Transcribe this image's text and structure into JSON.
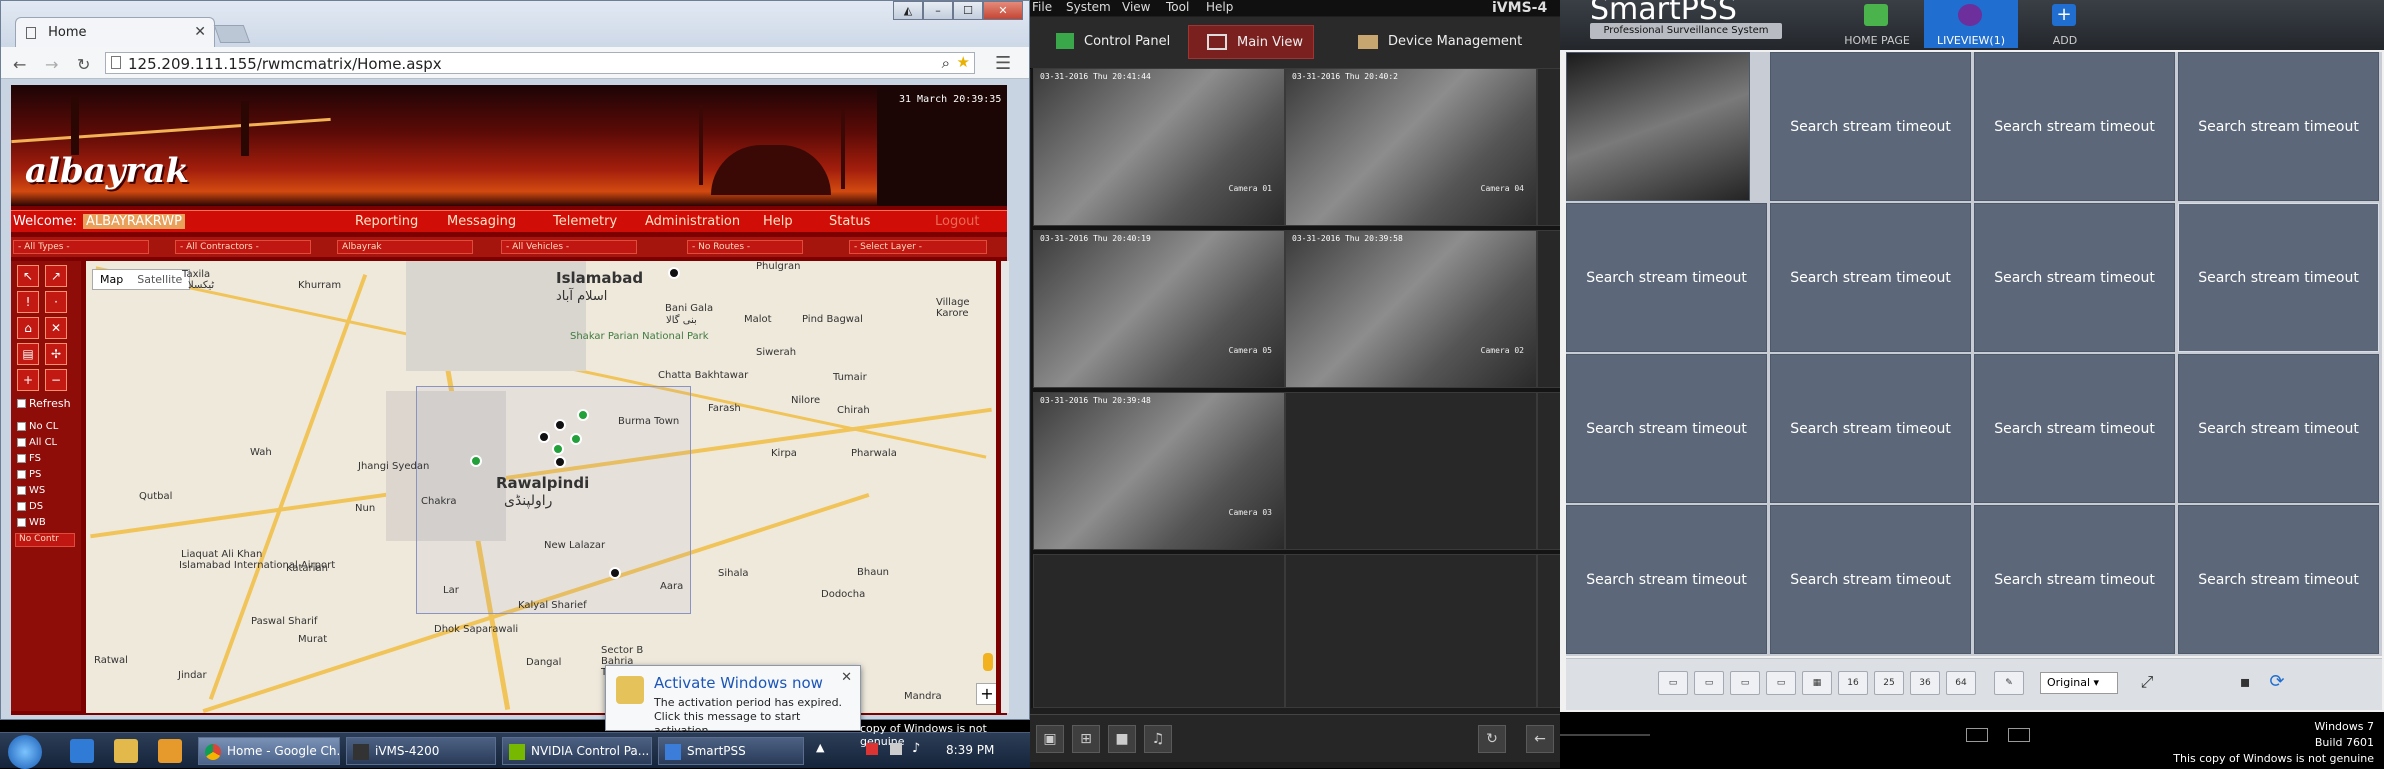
{
  "chrome": {
    "tab_title": "Home",
    "url": "125.209.111.155/rwmcmatrix/Home.aspx",
    "page": {
      "logo": "albayrak",
      "datetime": "31 March 20:39:35",
      "welcome_label": "Welcome:",
      "welcome_user": "ALBAYRAKRWP",
      "menu": [
        "Reporting",
        "Messaging",
        "Telemetry",
        "Administration",
        "Help",
        "Status"
      ],
      "logout": "Logout",
      "filters": [
        "- All Types -",
        "- All Contractors -",
        "Albayrak",
        "- All Vehicles -",
        "- No Routes -",
        "- Select Layer -"
      ],
      "refresh_label": "Refresh",
      "layer_checks": [
        "No CL",
        "All CL",
        "FS",
        "PS",
        "WS",
        "DS",
        "WB"
      ],
      "contract_dropdown": "No Contr",
      "map_toggle": [
        "Map",
        "Satellite"
      ],
      "map_places": [
        "Islamabad",
        "اسلام آباد",
        "Khurram",
        "Taxila",
        "ٹیکسلا",
        "Bani Gala",
        "بنی گالا",
        "Malot",
        "Phulgran",
        "Village Karore",
        "Pind Bagwal",
        "Shakar Parian National Park",
        "Siwerah",
        "Chatta Bakhtawar",
        "Tumair",
        "Farash",
        "Nilore",
        "Chirah",
        "Burma Town",
        "Wah",
        "Jhangi Syedan",
        "Rawalpindi",
        "راولپنڈی",
        "Kirpa",
        "Pharwala",
        "Qutbal",
        "Nun",
        "Chakra",
        "New Lalazar",
        "Sihala",
        "Bhaun",
        "Liaquat Ali Khan",
        "Islamabad International Airport",
        "Katarian",
        "Lar",
        "Aara",
        "Kalyal Sharief",
        "Dodocha",
        "Paswal Sharif",
        "Dhok Saparawali",
        "Murat",
        "Ratwal",
        "Jindar",
        "Dangal",
        "Sector B Bahria Town",
        "Mandra"
      ]
    },
    "notification": {
      "title": "Activate Windows now",
      "body": "The activation period has expired. Click this message to start activation."
    }
  },
  "ivms": {
    "title": "iVMS-4",
    "menu": [
      "File",
      "System",
      "View",
      "Tool",
      "Help"
    ],
    "tabs": [
      "Control Panel",
      "Main View",
      "Device Management"
    ],
    "cameras": [
      {
        "ts": "03-31-2016 Thu 20:41:44",
        "name": "Camera 01"
      },
      {
        "ts": "03-31-2016 Thu 20:40:2",
        "name": "Camera 04"
      },
      {
        "ts": "03-31-2016 Thu 20:40:19",
        "name": "Camera 05"
      },
      {
        "ts": "03-31-2016 Thu 20:39:58",
        "name": "Camera 02"
      },
      {
        "ts": "03-31-2016 Thu 20:39:48",
        "name": "Camera 03"
      }
    ]
  },
  "smartpss": {
    "logo": "SmartPSS",
    "subtitle": "Professional Surveillance System",
    "nav": [
      "HOME PAGE",
      "LIVEVIEW(1)",
      "ADD"
    ],
    "timeout_text": "Search stream timeout",
    "layouts": [
      "16",
      "25",
      "36",
      "64"
    ],
    "stream_option": "Original",
    "watermark": [
      "Windows 7",
      "Build 7601",
      "This copy of Windows is not genuine"
    ]
  },
  "taskbar": {
    "items": [
      "Home - Google Ch...",
      "iVMS-4200",
      "NVIDIA Control Pa...",
      "SmartPSS"
    ],
    "clock": "8:39 PM",
    "genuine": "copy of Windows is not genuine"
  }
}
